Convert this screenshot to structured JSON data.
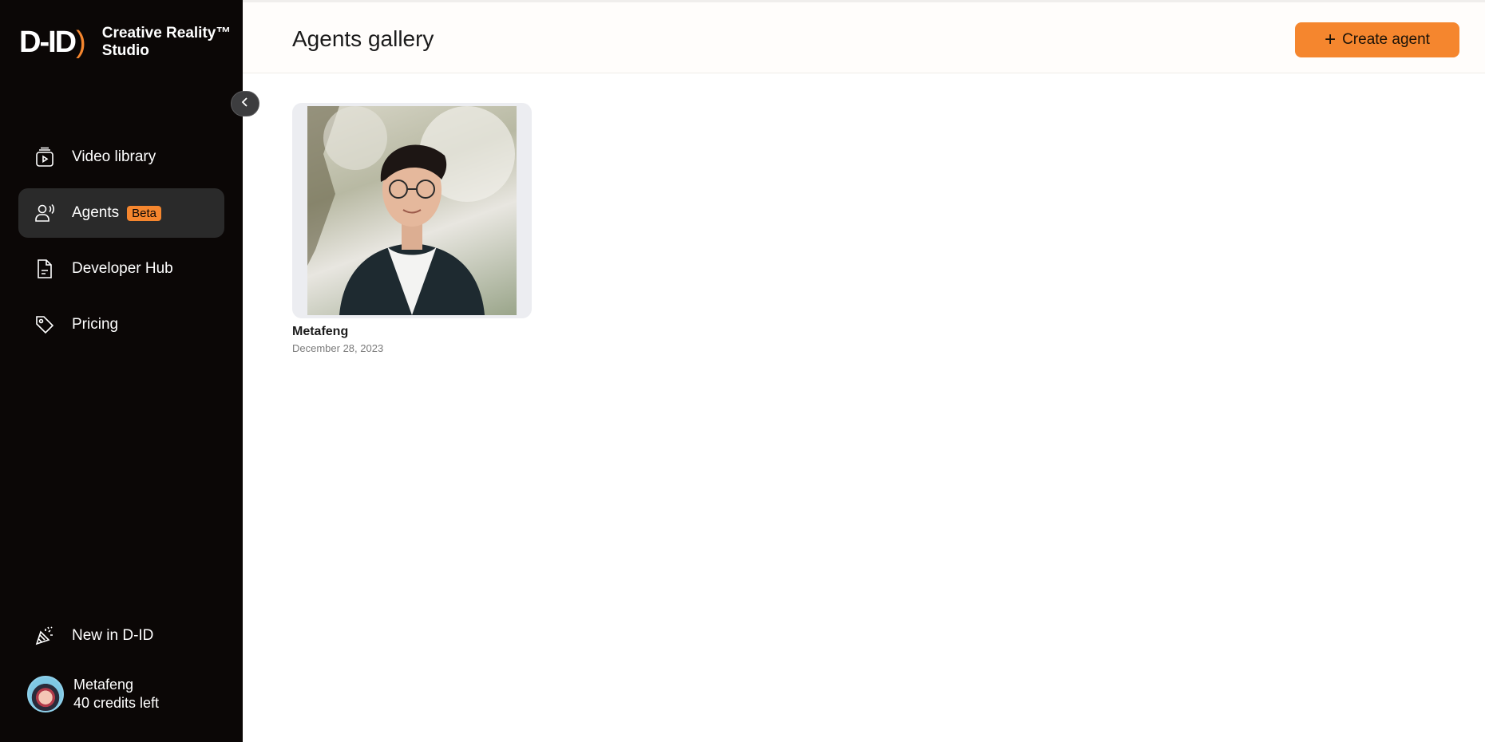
{
  "sidebar": {
    "logo_text": "D-ID",
    "brand_name_line1": "Creative Reality™",
    "brand_name_line2": "Studio",
    "items": [
      {
        "label": "Video library",
        "icon": "video-library-icon"
      },
      {
        "label": "Agents",
        "icon": "agents-icon",
        "badge": "Beta",
        "active": true
      },
      {
        "label": "Developer Hub",
        "icon": "document-icon"
      },
      {
        "label": "Pricing",
        "icon": "tag-icon"
      }
    ],
    "bottom_item": {
      "label": "New in D-ID",
      "icon": "party-popper-icon"
    },
    "profile": {
      "name": "Metafeng",
      "credits": "40 credits left"
    }
  },
  "header": {
    "title": "Agents gallery",
    "create_button": "Create agent"
  },
  "agents": [
    {
      "name": "Metafeng",
      "date": "December 28, 2023"
    }
  ],
  "colors": {
    "accent": "#f5862e",
    "sidebar_bg": "#0b0706",
    "active_item_bg": "#2a2a2a"
  }
}
